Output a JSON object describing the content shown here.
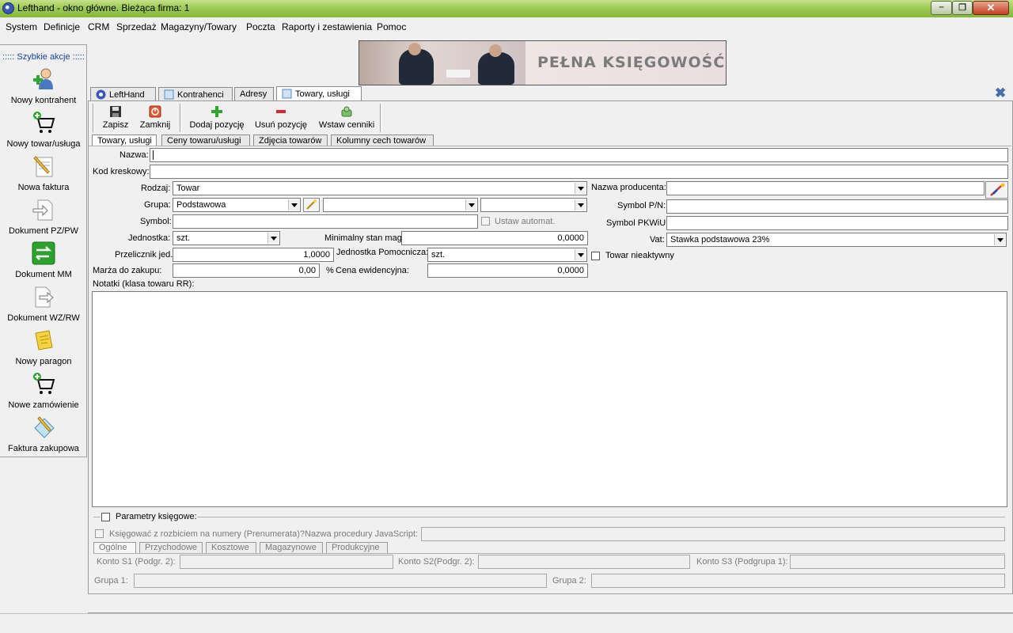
{
  "window": {
    "title": "Lefthand - okno główne. Bieżąca firma: 1"
  },
  "menu": [
    "System",
    "Definicje",
    "CRM",
    "Sprzedaż",
    "Magazyny/Towary",
    "Poczta",
    "Raporty i zestawienia",
    "Pomoc"
  ],
  "sidebar": {
    "header": "::::: Szybkie akcje :::::",
    "items": [
      {
        "label": "Nowy kontrahent",
        "icon": "add-contractor-icon"
      },
      {
        "label": "Nowy towar/usługa",
        "icon": "cart-add-icon"
      },
      {
        "label": "Nowa faktura",
        "icon": "invoice-pencil-icon"
      },
      {
        "label": "Dokument PZ/PW",
        "icon": "document-in-icon"
      },
      {
        "label": "Dokument MM",
        "icon": "transfer-arrows-icon"
      },
      {
        "label": "Dokument WZ/RW",
        "icon": "document-out-icon"
      },
      {
        "label": "Nowy paragon",
        "icon": "receipt-icon"
      },
      {
        "label": "Nowe zamówienie",
        "icon": "cart-order-icon"
      },
      {
        "label": "Faktura zakupowa",
        "icon": "purchase-invoice-icon"
      }
    ]
  },
  "banner": {
    "text": "PEŁNA KSIĘGOWOŚĆ"
  },
  "tabs": [
    "LeftHand",
    "Kontrahenci",
    "Adresy",
    "Towary, usługi"
  ],
  "toolbar": {
    "save": "Zapisz",
    "close": "Zamknij",
    "add_position": "Dodaj pozycję",
    "remove_position": "Usuń pozycję",
    "insert_pricelists": "Wstaw cenniki"
  },
  "subtabs": [
    "Towary, usługi",
    "Ceny towaru/usługi",
    "Zdjęcia towarów",
    "Kolumny cech towarów"
  ],
  "form": {
    "name_label": "Nazwa:",
    "name_value": "",
    "barcode_label": "Kod kreskowy:",
    "barcode_value": "",
    "kind_label": "Rodzaj:",
    "kind_value": "Towar",
    "group_label": "Grupa:",
    "group_value": "Podstawowa",
    "group2_value": "",
    "group3_value": "",
    "symbol_label": "Symbol:",
    "symbol_value": "",
    "auto_set_label": "Ustaw automat.",
    "unit_label": "Jednostka:",
    "unit_value": "szt.",
    "min_stock_label": "Minimalny stan mag.",
    "min_stock_value": "0,0000",
    "converter_label": "Przelicznik jed.",
    "converter_value": "1,0000",
    "aux_unit_label": "Jednostka Pomocnicza:",
    "aux_unit_value": "szt.",
    "margin_label": "Marża do zakupu:",
    "margin_value": "0,00",
    "percent_sign": "%",
    "record_price_label": "Cena ewidencyjna:",
    "record_price_value": "0,0000",
    "producer_label": "Nazwa producenta:",
    "producer_value": "",
    "pn_label": "Symbol P/N:",
    "pn_value": "",
    "pkwiu_label": "Symbol PKWiU:",
    "pkwiu_value": "",
    "vat_label": "Vat:",
    "vat_value": "Stawka podstawowa 23%",
    "inactive_label": "Towar nieaktywny",
    "notes_label": "Notatki (klasa towaru RR):"
  },
  "accounting": {
    "params_label": "Parametry księgowe:",
    "prenumerata_label": "Księgować z rozbiciem na numery (Prenumerata)?",
    "js_procedure_label": "Nazwa procedury JavaScript:",
    "tabs": [
      "Ogólne",
      "Przychodowe",
      "Kosztowe",
      "Magazynowe",
      "Produkcyjne"
    ],
    "s1_label": "Konto S1 (Podgr. 2):",
    "s2_label": "Konto S2(Podgr. 2):",
    "s3_label": "Konto S3 (Podgrupa 1):",
    "group1_label": "Grupa 1:",
    "group2_label": "Grupa 2:"
  },
  "colors": {
    "titlebar": "#9ecb55",
    "accent_blue": "#1a3fa0"
  }
}
